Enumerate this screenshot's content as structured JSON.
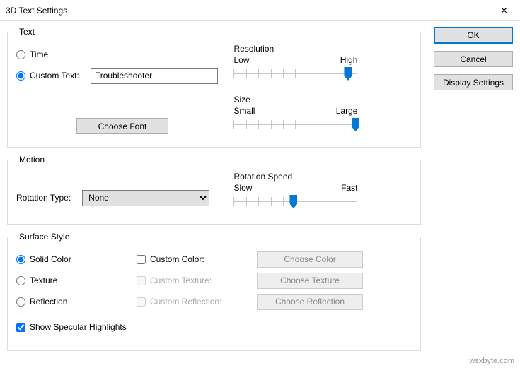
{
  "window": {
    "title": "3D Text Settings",
    "close": "✕"
  },
  "buttons": {
    "ok": "OK",
    "cancel": "Cancel",
    "display": "Display Settings"
  },
  "text": {
    "legend": "Text",
    "time": "Time",
    "custom": "Custom Text:",
    "custom_value": "Troubleshooter",
    "choose_font": "Choose Font",
    "resolution": {
      "label": "Resolution",
      "low": "Low",
      "high": "High",
      "pct": 92
    },
    "size": {
      "label": "Size",
      "small": "Small",
      "large": "Large",
      "pct": 98
    }
  },
  "motion": {
    "legend": "Motion",
    "rotation_type": "Rotation Type:",
    "rotation_value": "None",
    "speed": {
      "label": "Rotation Speed",
      "slow": "Slow",
      "fast": "Fast",
      "pct": 48
    }
  },
  "surface": {
    "legend": "Surface Style",
    "solid": "Solid Color",
    "texture": "Texture",
    "reflection": "Reflection",
    "custom_color": "Custom Color:",
    "custom_texture": "Custom Texture:",
    "custom_reflection": "Custom Reflection:",
    "choose_color": "Choose Color",
    "choose_texture": "Choose Texture",
    "choose_reflection": "Choose Reflection",
    "specular": "Show Specular Highlights"
  },
  "watermark": "wsxbyte.com"
}
